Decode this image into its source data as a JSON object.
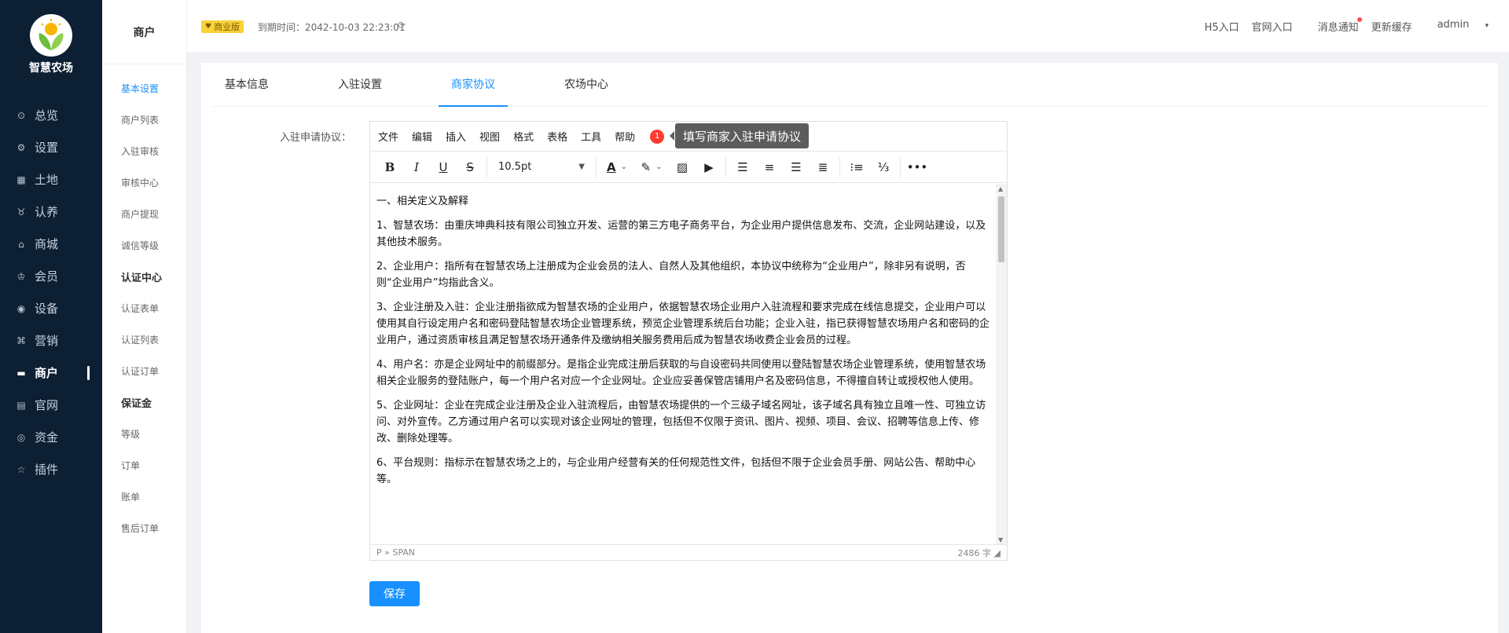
{
  "app": {
    "logo_text": "智慧农场"
  },
  "main_menu": [
    {
      "label": "总览",
      "icon": "dashboard-icon",
      "glyph": "⊙"
    },
    {
      "label": "设置",
      "icon": "gear-icon",
      "glyph": "⚙"
    },
    {
      "label": "土地",
      "icon": "land-icon",
      "glyph": "▦"
    },
    {
      "label": "认养",
      "icon": "adopt-icon",
      "glyph": "♉"
    },
    {
      "label": "商城",
      "icon": "store-icon",
      "glyph": "⌂"
    },
    {
      "label": "会员",
      "icon": "member-icon",
      "glyph": "♔"
    },
    {
      "label": "设备",
      "icon": "device-icon",
      "glyph": "◉"
    },
    {
      "label": "营销",
      "icon": "marketing-icon",
      "glyph": "⌘"
    },
    {
      "label": "商户",
      "icon": "merchant-icon",
      "glyph": "▬",
      "active": true
    },
    {
      "label": "官网",
      "icon": "website-icon",
      "glyph": "▤"
    },
    {
      "label": "资金",
      "icon": "funds-icon",
      "glyph": "◎"
    },
    {
      "label": "插件",
      "icon": "plugin-icon",
      "glyph": "☆"
    }
  ],
  "sub_menu": {
    "title": "商户",
    "items": [
      {
        "label": "基本设置",
        "type": "on"
      },
      {
        "label": "商户列表",
        "type": ""
      },
      {
        "label": "入驻审核",
        "type": ""
      },
      {
        "label": "审核中心",
        "type": ""
      },
      {
        "label": "商户提现",
        "type": ""
      },
      {
        "label": "诚信等级",
        "type": ""
      },
      {
        "label": "认证中心",
        "type": "grp"
      },
      {
        "label": "认证表单",
        "type": ""
      },
      {
        "label": "认证列表",
        "type": ""
      },
      {
        "label": "认证订单",
        "type": ""
      },
      {
        "label": "保证金",
        "type": "grp"
      },
      {
        "label": "等级",
        "type": ""
      },
      {
        "label": "订单",
        "type": ""
      },
      {
        "label": "账单",
        "type": ""
      },
      {
        "label": "售后订单",
        "type": ""
      }
    ]
  },
  "header": {
    "edition_badge": "商业版",
    "expire_text": "到期时间：2042-10-03 22:23:01",
    "links": [
      "H5入口",
      "官网入口",
      "消息通知",
      "更新缓存"
    ],
    "user": "admin"
  },
  "tabs": [
    {
      "label": "基本信息",
      "active": false
    },
    {
      "label": "入驻设置",
      "active": false
    },
    {
      "label": "商家协议",
      "active": true
    },
    {
      "label": "农场中心",
      "active": false
    }
  ],
  "form": {
    "label": "入驻申请协议："
  },
  "editor": {
    "menus": [
      "文件",
      "编辑",
      "插入",
      "视图",
      "格式",
      "表格",
      "工具",
      "帮助"
    ],
    "notif_count": "1",
    "tooltip": "填写商家入驻申请协议",
    "font_size": "10.5pt",
    "paragraphs": [
      "一、相关定义及解释",
      "1、智慧农场：由重庆坤典科技有限公司独立开发、运营的第三方电子商务平台，为企业用户提供信息发布、交流，企业网站建设，以及其他技术服务。",
      "2、企业用户：指所有在智慧农场上注册成为企业会员的法人、自然人及其他组织，本协议中统称为“企业用户”，除非另有说明，否则“企业用户”均指此含义。",
      "3、企业注册及入驻：企业注册指欲成为智慧农场的企业用户，依据智慧农场企业用户入驻流程和要求完成在线信息提交，企业用户可以使用其自行设定用户名和密码登陆智慧农场企业管理系统，预览企业管理系统后台功能；企业入驻，指已获得智慧农场用户名和密码的企业用户，通过资质审核且满足智慧农场开通条件及缴纳相关服务费用后成为智慧农场收费企业会员的过程。",
      "4、用户名：亦是企业网址中的前缀部分。是指企业完成注册后获取的与自设密码共同使用以登陆智慧农场企业管理系统，使用智慧农场相关企业服务的登陆账户，每一个用户名对应一个企业网址。企业应妥善保管店铺用户名及密码信息，不得擅自转让或授权他人使用。",
      "5、企业网址：企业在完成企业注册及企业入驻流程后，由智慧农场提供的一个三级子域名网址，该子域名具有独立且唯一性、可独立访问、对外宣传。乙方通过用户名可以实现对该企业网址的管理，包括但不仅限于资讯、图片、视频、项目、会议、招聘等信息上传、修改、删除处理等。",
      "6、平台规则：指标示在智慧农场之上的，与企业用户经营有关的任何规范性文件，包括但不限于企业会员手册、网站公告、帮助中心等。"
    ],
    "path": "P » SPAN",
    "word_count": "2486 字"
  },
  "save_label": "保存",
  "colors": {
    "primary": "#1890ff",
    "sidebar": "#0c1f33",
    "badge": "#f9d13a"
  }
}
